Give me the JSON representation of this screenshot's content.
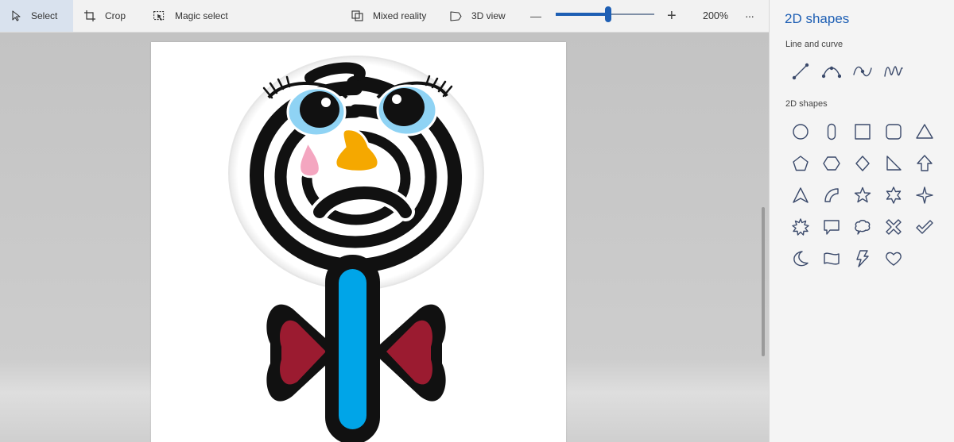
{
  "toolbar": {
    "select_label": "Select",
    "crop_label": "Crop",
    "magic_select_label": "Magic select",
    "mixed_reality_label": "Mixed reality",
    "view_3d_label": "3D view",
    "zoom_out_glyph": "—",
    "zoom_in_glyph": "+",
    "zoom_value": "200%",
    "zoom_slider_fraction": 0.53,
    "more_glyph": "···"
  },
  "panel": {
    "title": "2D shapes",
    "line_section_label": "Line and curve",
    "shapes_section_label": "2D shapes",
    "line_tools": [
      "line-icon",
      "curve-icon",
      "s-curve-icon",
      "wave-curve-icon"
    ],
    "shape_tools": [
      "circle-icon",
      "capsule-icon",
      "square-icon",
      "rounded-square-icon",
      "triangle-icon",
      "pentagon-icon",
      "hexagon-icon",
      "diamond-icon",
      "right-triangle-icon",
      "arrow-up-icon",
      "arrowhead-icon",
      "quarter-circle-icon",
      "five-point-star-icon",
      "six-point-star-icon",
      "four-point-star-icon",
      "burst-icon",
      "speech-bubble-icon",
      "thought-bubble-icon",
      "x-icon",
      "checkmark-icon",
      "crescent-moon-icon",
      "banner-icon",
      "lightning-icon",
      "heart-icon"
    ]
  },
  "colors": {
    "accent": "#1e5fb4",
    "panel_bg": "#f4f4f4",
    "toolbar_bg": "#f2f2f2",
    "workspace_bg": "#c9c9c9",
    "drawing_black": "#111111",
    "eye_blue": "#8fd3f4",
    "nose_orange": "#f5a800",
    "tear_pink": "#f4a6c0",
    "body_blue": "#00a5e8",
    "bow_red": "#9b1b30"
  }
}
